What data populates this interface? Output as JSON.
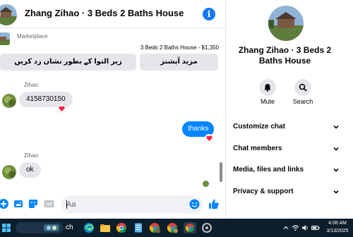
{
  "chat": {
    "title": "Zhang Zihao · 3 Beds 2 Baths House",
    "info_icon": "info-icon",
    "listing": {
      "source": "Marketplace",
      "detail": "3 Beds 2 Baths House - $1,350",
      "mark_pending_label": "زیر التوا کے بطور نشان زد کریں",
      "more_options_label": "مزید آپشنز"
    },
    "messages": [
      {
        "sender": "Zihao",
        "text": "4158730150",
        "direction": "incoming",
        "reaction": "heart"
      },
      {
        "sender": "",
        "text": "thanks",
        "direction": "outgoing",
        "reaction": "heart"
      },
      {
        "sender": "Zihao",
        "text": "ok",
        "direction": "incoming",
        "reaction": ""
      }
    ],
    "composer": {
      "placeholder": "Aa",
      "value": ""
    }
  },
  "details": {
    "name": "Zhang Zihao · 3 Beds 2 Baths House",
    "actions": [
      {
        "label": "Mute",
        "icon": "bell-icon"
      },
      {
        "label": "Search",
        "icon": "search-icon"
      }
    ],
    "menu": [
      {
        "label": "Customize chat"
      },
      {
        "label": "Chat members"
      },
      {
        "label": "Media, files and links"
      },
      {
        "label": "Privacy & support"
      }
    ]
  },
  "taskbar": {
    "search_text": "ch",
    "time": "4:08 AM",
    "date": "3/13/2025"
  },
  "colors": {
    "accent": "#0084ff",
    "info": "#1877f2",
    "bubble_in": "#e4e6eb",
    "heart": "#f02849",
    "taskbar": "#0c1d2b"
  }
}
